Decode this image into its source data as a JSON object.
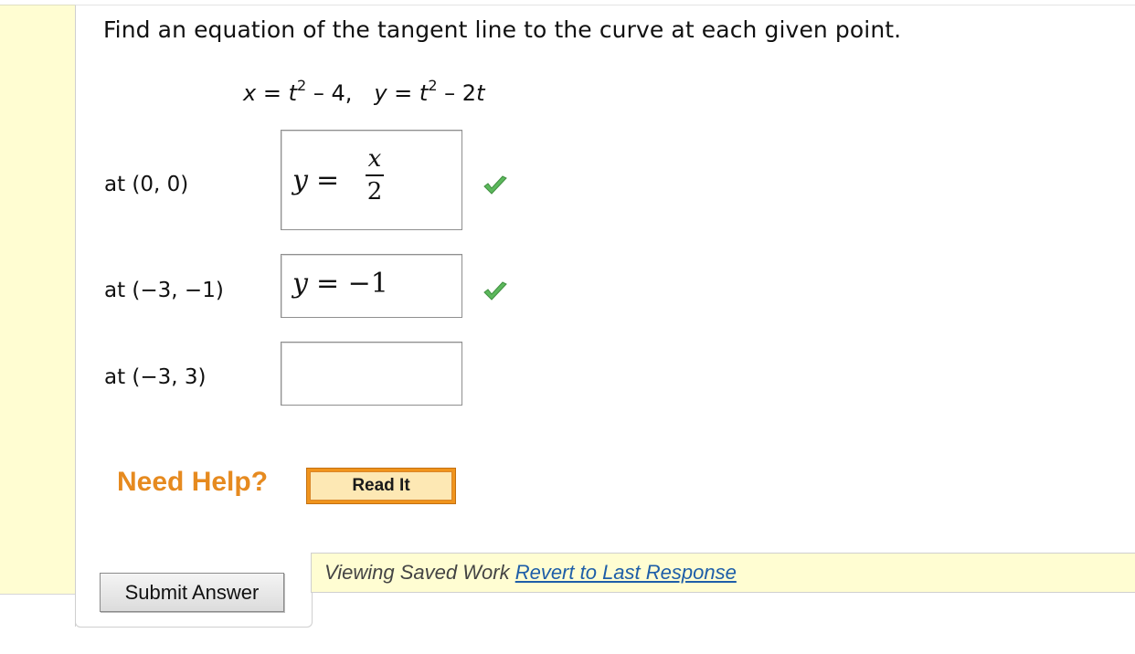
{
  "question": {
    "prompt": "Find an equation of the tangent line to the curve at each given point."
  },
  "equation": {
    "x_var": "x",
    "x_eq": " = ",
    "x_base": "t",
    "x_exp": "2",
    "x_rest": " – 4,",
    "y_var": "y",
    "y_eq": " = ",
    "y_base": "t",
    "y_exp": "2",
    "y_rest": " – 2",
    "y_tail_var": "t"
  },
  "parts": [
    {
      "label": "at (0, 0)",
      "answer_lhs": "y",
      "answer_eq": "=",
      "answer_num": "x",
      "answer_den": "2",
      "status": "correct"
    },
    {
      "label": "at (−3, −1)",
      "answer_lhs": "y",
      "answer_rhs": "= −1",
      "status": "correct"
    },
    {
      "label": "at (−3, 3)",
      "answer_value": "",
      "status": "empty"
    }
  ],
  "help": {
    "need_help_label": "Need Help?",
    "read_it_label": "Read It"
  },
  "saved_work": {
    "status_text": "Viewing Saved Work ",
    "revert_link": "Revert to Last Response"
  },
  "submit": {
    "label": "Submit Answer"
  },
  "colors": {
    "check_green": "#5cb85c",
    "help_orange": "#e68a1f",
    "saved_bg": "#fffdd2",
    "link_blue": "#1e5ea8"
  },
  "icons": {
    "correct": "checkmark-icon"
  }
}
